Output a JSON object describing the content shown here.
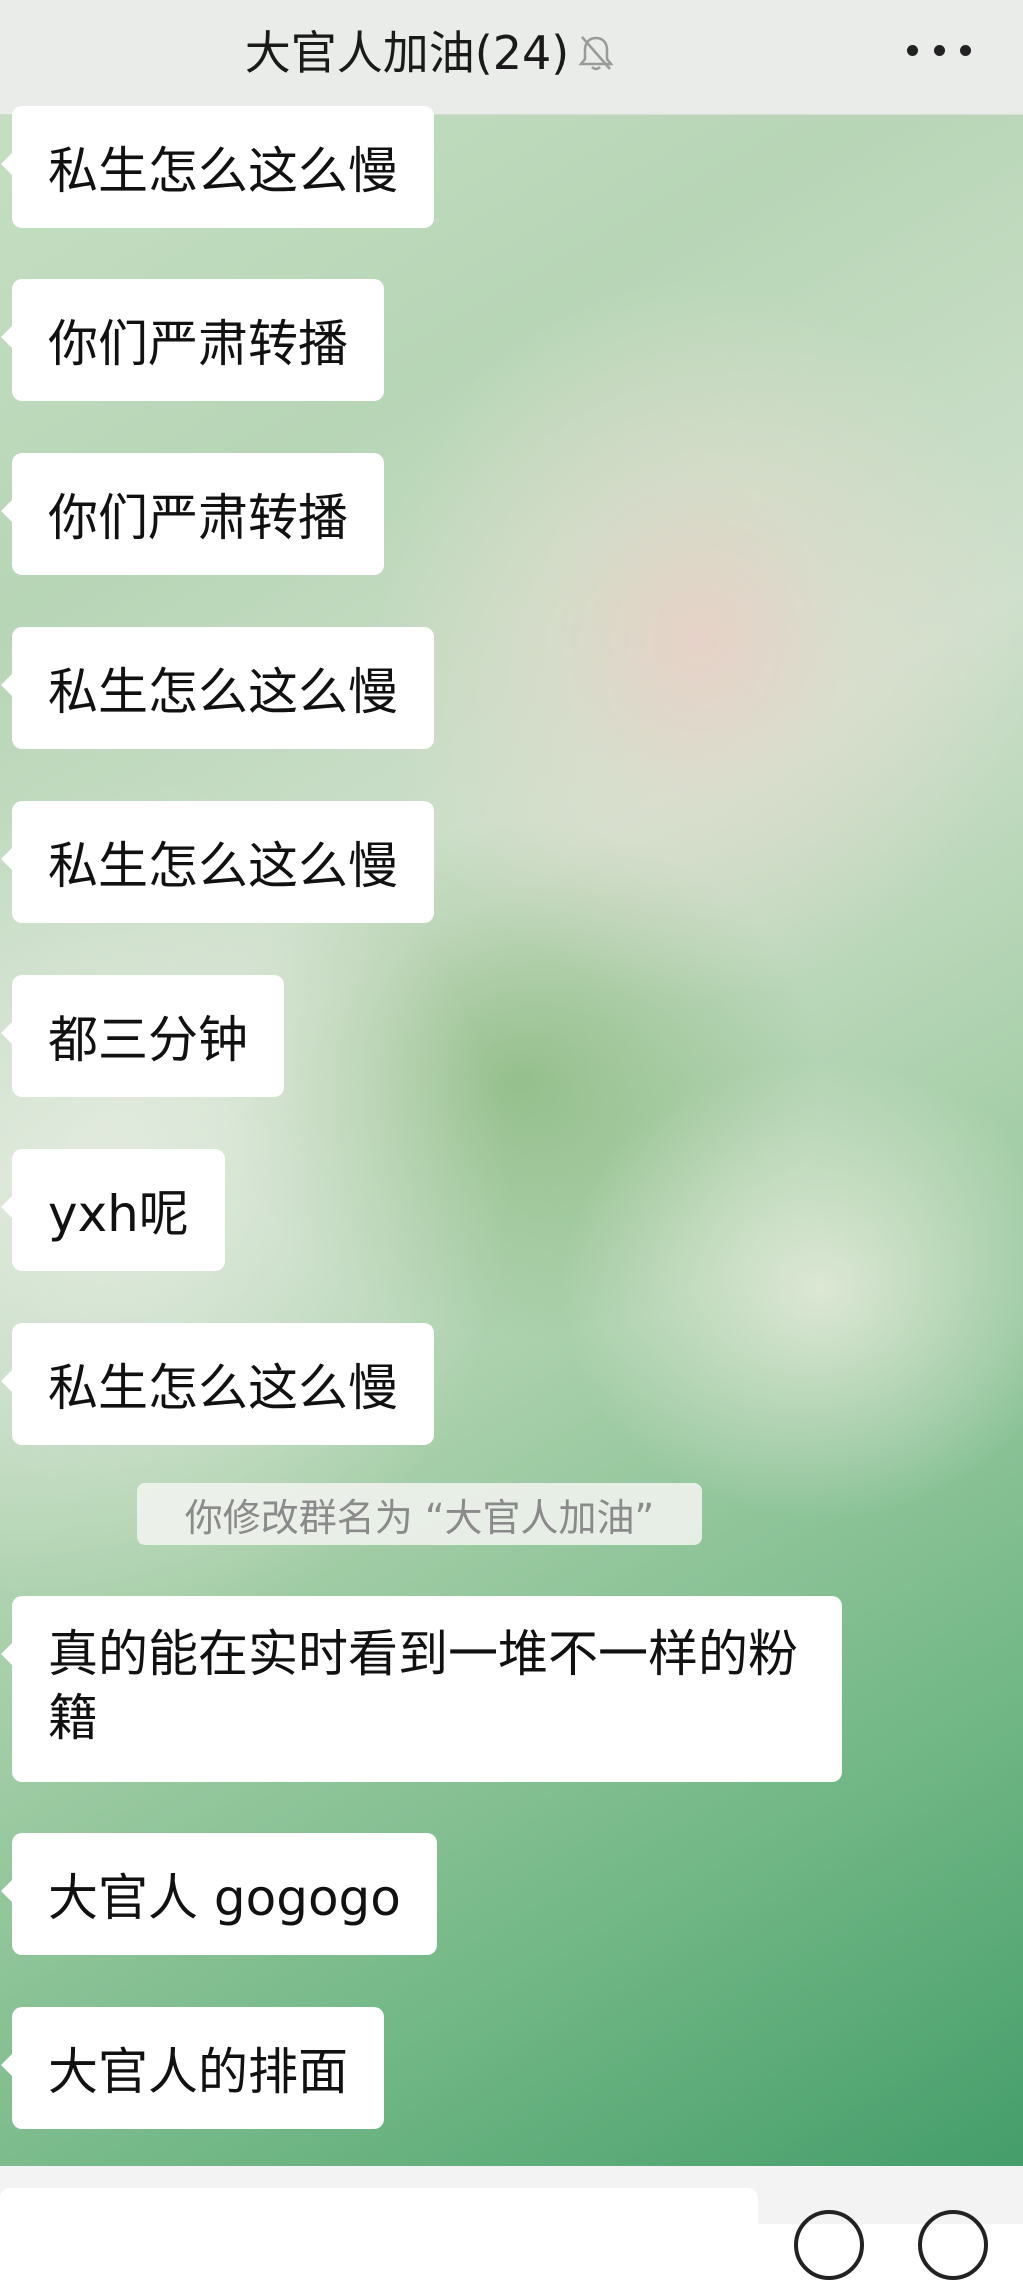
{
  "header": {
    "title": "大官人加油(24)",
    "mute_icon": "bell-off-icon",
    "more_icon": "more-dots-icon"
  },
  "messages": [
    {
      "text": "私生怎么这么慢"
    },
    {
      "text": "你们严肃转播"
    },
    {
      "text": "你们严肃转播"
    },
    {
      "text": "私生怎么这么慢"
    },
    {
      "text": "私生怎么这么慢"
    },
    {
      "text": "都三分钟"
    },
    {
      "text": "yxh呢"
    },
    {
      "text": "私生怎么这么慢"
    }
  ],
  "system_notice": "你修改群名为 “大官人加油”",
  "messages_after": [
    {
      "text": "真的能在实时看到一堆不一样的粉籍"
    },
    {
      "text": "大官人 gogogo"
    },
    {
      "text": "大官人的排面"
    }
  ],
  "input_bar": {
    "voice_icon": "voice-icon",
    "emoji_icon": "emoji-icon"
  }
}
